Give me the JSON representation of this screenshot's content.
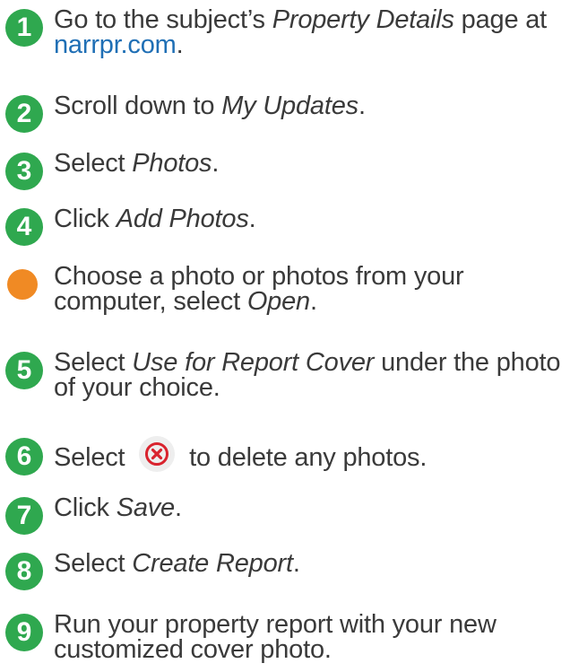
{
  "colors": {
    "green_badge": "#2fa84f",
    "orange_dot": "#f08a24",
    "link": "#1f6fb5",
    "text": "#3a3a3a",
    "delete_icon_red": "#d9232e",
    "delete_icon_bg": "#eeeeee"
  },
  "steps": [
    {
      "number": "1",
      "parts": [
        "Go to the subject’s ",
        "Property Details",
        " page at ",
        "narrpr.com",
        "."
      ]
    },
    {
      "number": "2",
      "parts": [
        "Scroll down to ",
        "My Updates",
        "."
      ]
    },
    {
      "number": "3",
      "parts": [
        "Select ",
        "Photos",
        "."
      ]
    },
    {
      "number": "4",
      "parts": [
        "Click ",
        "Add Photos",
        "."
      ]
    },
    {
      "number": "",
      "parts": [
        "Choose a photo or photos from your computer, select ",
        "Open",
        "."
      ]
    },
    {
      "number": "5",
      "parts": [
        "Select ",
        "Use for Report Cover",
        " under the photo of your choice."
      ]
    },
    {
      "number": "6",
      "parts": [
        "Select ",
        " to delete any photos."
      ],
      "icon": "delete-x-circle-icon"
    },
    {
      "number": "7",
      "parts": [
        "Click ",
        "Save",
        "."
      ]
    },
    {
      "number": "8",
      "parts": [
        "Select ",
        "Create Report",
        "."
      ]
    },
    {
      "number": "9",
      "parts": [
        "Run your property report with your new customized cover photo."
      ]
    }
  ]
}
